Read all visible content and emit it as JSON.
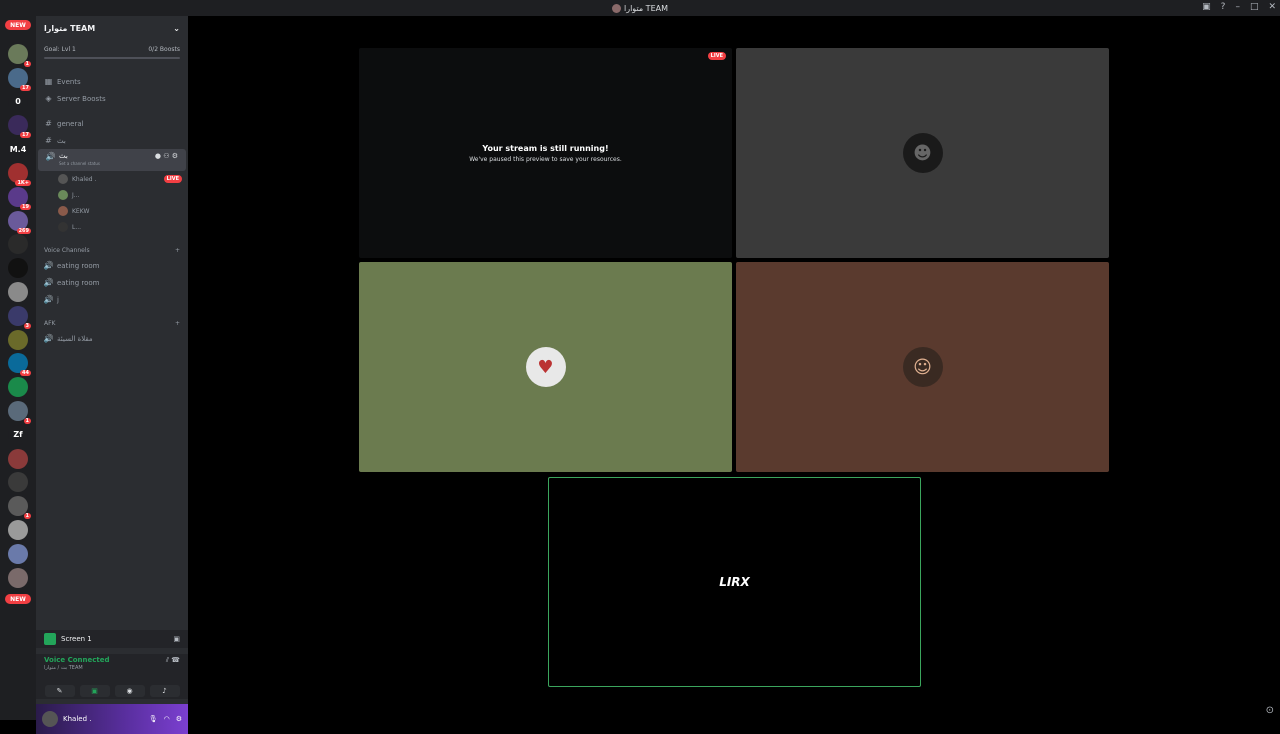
{
  "window": {
    "title": "متوارا TEAM"
  },
  "servers": [
    {
      "label": "",
      "badge": "1",
      "color": "#6a7a5a"
    },
    {
      "label": "",
      "badge": "17",
      "color": "#4a6a8a"
    },
    {
      "label": "0",
      "badge": "",
      "color": "#1e1f22"
    },
    {
      "label": "",
      "badge": "17",
      "color": "#3a2a5a"
    },
    {
      "label": "M.4",
      "badge": "",
      "color": "#1e1f22"
    },
    {
      "label": "",
      "badge": "1K+",
      "color": "#a03030"
    },
    {
      "label": "",
      "badge": "19",
      "color": "#5a3a8a"
    },
    {
      "label": "",
      "badge": "269",
      "color": "#6a5a9a"
    },
    {
      "label": "",
      "badge": "",
      "color": "#2a2a2a"
    },
    {
      "label": "",
      "badge": "",
      "color": "#111"
    },
    {
      "label": "",
      "badge": "",
      "color": "#8a8a8a"
    },
    {
      "label": "",
      "badge": "3",
      "color": "#3a3a6a"
    },
    {
      "label": "",
      "badge": "",
      "color": "#6a6a2a"
    },
    {
      "label": "",
      "badge": "44",
      "color": "#0a6a9a"
    },
    {
      "label": "",
      "badge": "",
      "color": "#1a8a4a"
    },
    {
      "label": "",
      "badge": "1",
      "color": "#5a6a7a"
    },
    {
      "label": "Zf",
      "badge": "",
      "color": "#1e1f22"
    },
    {
      "label": "",
      "badge": "",
      "color": "#8a3a3a"
    },
    {
      "label": "",
      "badge": "",
      "color": "#3a3a3a"
    },
    {
      "label": "",
      "badge": "1",
      "color": "#5a5a5a"
    },
    {
      "label": "",
      "badge": "",
      "color": "#9a9a9a"
    },
    {
      "label": "",
      "badge": "",
      "color": "#6a7aaa"
    },
    {
      "label": "",
      "badge": "",
      "color": "#7a6a6a"
    }
  ],
  "new_label": "NEW",
  "server": {
    "name": "متوارا TEAM",
    "goal": "Goal: Lvl 1",
    "boosts": "0/2 Boosts",
    "events": "Events",
    "server_boosts": "Server Boosts"
  },
  "channels": {
    "general": "general",
    "bt": "بث",
    "active_voice": "بث",
    "status_hint": "Set a channel status",
    "voice_users": [
      {
        "name": "Khaled .",
        "live": "LIVE",
        "color": "#555"
      },
      {
        "name": "J...",
        "live": "",
        "color": "#6a8a5a"
      },
      {
        "name": "KEKW",
        "live": "",
        "color": "#8a5a4a"
      },
      {
        "name": "L...",
        "live": "",
        "color": "#333"
      }
    ],
    "voice_category": "Voice Channels",
    "voice_channels": [
      "eating room",
      "eating room",
      "j"
    ],
    "afk_category": "AFK",
    "afk_channel": "مقلاة السيئة"
  },
  "screen_share": {
    "label": "Screen 1"
  },
  "voice_connected": {
    "status": "Voice Connected",
    "location": "بث / متوارا TEAM"
  },
  "user": {
    "name": "Khaled ."
  },
  "tiles": {
    "stream_title": "Your stream is still running!",
    "stream_sub": "We've paused this preview to save your resources.",
    "live": "LIVE",
    "logo_text": "LIRX"
  },
  "colors": {
    "tile_dark": "#0c0d0e",
    "tile_gray": "#3a3a3a",
    "tile_green": "#6b7b4f",
    "tile_brown": "#5a3a2e",
    "speaking": "#3ba55d"
  }
}
